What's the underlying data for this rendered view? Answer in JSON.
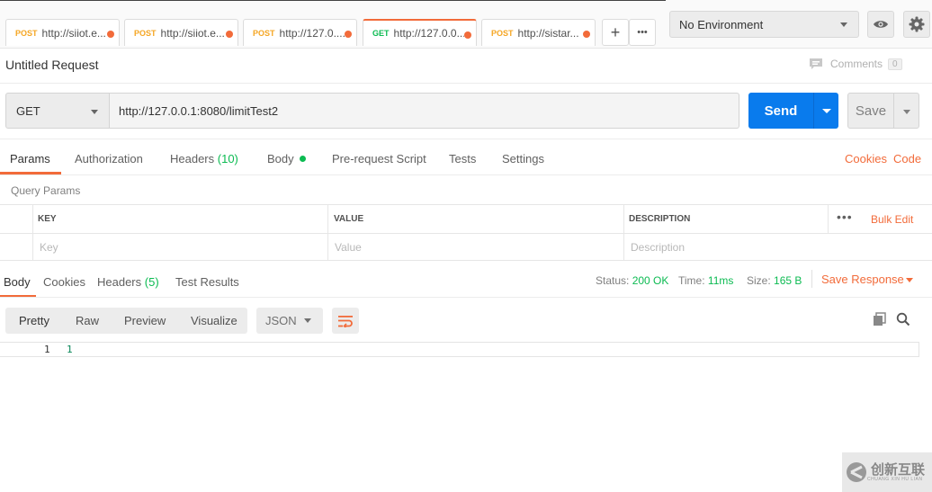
{
  "tabs": [
    {
      "method": "POST",
      "url": "http://siiot.e..."
    },
    {
      "method": "POST",
      "url": "http://siiot.e..."
    },
    {
      "method": "POST",
      "url": "http://127.0...."
    },
    {
      "method": "GET",
      "url": "http://127.0.0..."
    },
    {
      "method": "POST",
      "url": "http://sistar..."
    }
  ],
  "tab_controls": {
    "add": "+",
    "more": "•••"
  },
  "environment": {
    "selected": "No Environment"
  },
  "request": {
    "title": "Untitled Request",
    "comments_label": "Comments",
    "comments_count": "0",
    "method": "GET",
    "url": "http://127.0.0.1:8080/limitTest2",
    "send_label": "Send",
    "save_label": "Save"
  },
  "request_tabs": {
    "params": "Params",
    "authorization": "Authorization",
    "headers": "Headers",
    "headers_count": "(10)",
    "body": "Body",
    "pre_request": "Pre-request Script",
    "tests": "Tests",
    "settings": "Settings",
    "cookies": "Cookies",
    "code": "Code"
  },
  "query_params": {
    "label": "Query Params",
    "columns": [
      "KEY",
      "VALUE",
      "DESCRIPTION"
    ],
    "placeholders": [
      "Key",
      "Value",
      "Description"
    ],
    "more": "•••",
    "bulk_edit": "Bulk Edit"
  },
  "response": {
    "tabs": {
      "body": "Body",
      "cookies": "Cookies",
      "headers": "Headers",
      "headers_count": "(5)",
      "test_results": "Test Results"
    },
    "status_label": "Status:",
    "status_value": "200 OK",
    "time_label": "Time:",
    "time_value": "11ms",
    "size_label": "Size:",
    "size_value": "165 B",
    "save_response": "Save Response",
    "formats": [
      "Pretty",
      "Raw",
      "Preview",
      "Visualize"
    ],
    "language": "JSON",
    "lines": [
      {
        "no": "1",
        "text": "1"
      }
    ]
  },
  "watermark": {
    "text": "创新互联",
    "sub": "CHUANG XIN HU LIAN"
  },
  "colors": {
    "accent": "#f26b3a",
    "send": "#097bed",
    "success": "#0cbb52",
    "post": "#f5a623"
  }
}
